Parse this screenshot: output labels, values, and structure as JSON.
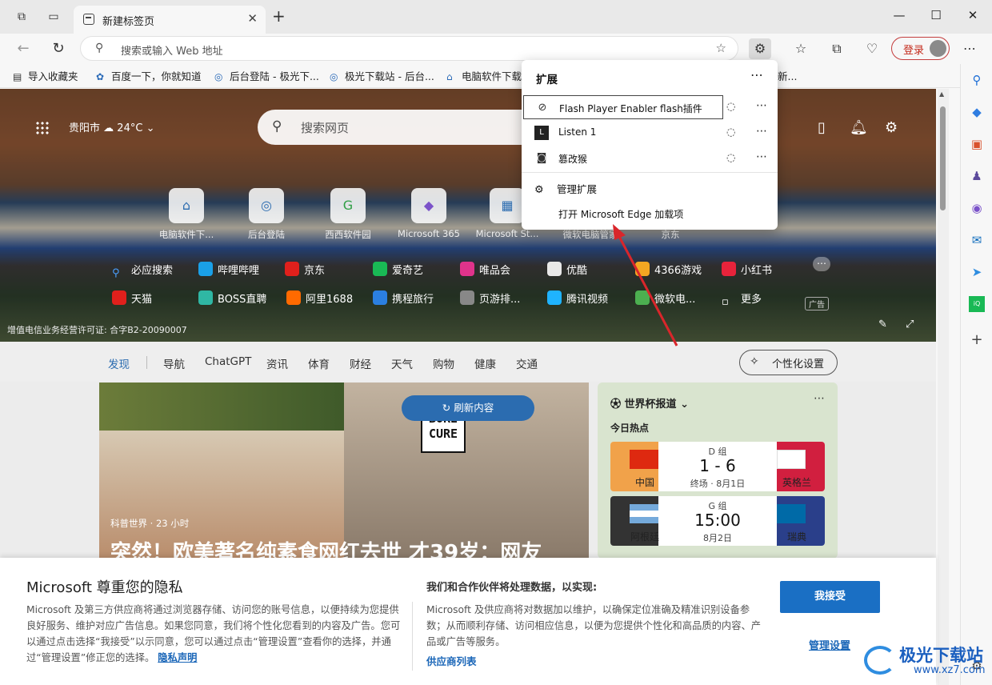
{
  "tab": {
    "title": "新建标签页"
  },
  "address": {
    "placeholder": "搜索或输入 Web 地址"
  },
  "toolbar": {
    "login": "登录"
  },
  "favorites": [
    {
      "label": "导入收藏夹"
    },
    {
      "label": "百度一下，你就知道"
    },
    {
      "label": "后台登陆 - 极光下..."
    },
    {
      "label": "极光下载站 - 后台..."
    },
    {
      "label": "电脑软件下载"
    },
    {
      "label": "新..."
    }
  ],
  "hero": {
    "city": "贵阳市",
    "temp": "24°C",
    "search_placeholder": "搜索网页",
    "tiles": [
      "电脑软件下...",
      "后台登陆",
      "西西软件园",
      "Microsoft 365",
      "Microsoft St...",
      "微软电脑管家",
      "京东"
    ],
    "links_row1": [
      "必应搜索",
      "哔哩哔哩",
      "京东",
      "爱奇艺",
      "唯品会",
      "优酷",
      "4366游戏",
      "小红书"
    ],
    "links_row2": [
      "天猫",
      "BOSS直聘",
      "阿里1688",
      "携程旅行",
      "页游排...",
      "腾讯视频",
      "微软电...",
      "更多"
    ],
    "ad": "广告",
    "license": "增值电信业务经营许可证: 合字B2-20090007"
  },
  "feed_nav": {
    "items": [
      "发现",
      "导航",
      "ChatGPT",
      "资讯",
      "体育",
      "财经",
      "天气",
      "购物",
      "健康",
      "交通"
    ],
    "personalize": "个性化设置"
  },
  "news": {
    "refresh": "刷新内容",
    "board": "BORE CURE",
    "source": "科普世界 · 23 小时",
    "headline": "突然！欧美著名纯素食网红去世 才39岁：网友"
  },
  "worldcup": {
    "title": "世界杯报道",
    "hot": "今日热点",
    "matches": [
      {
        "group": "D 组",
        "home": "中国",
        "away": "英格兰",
        "score": "1 - 6",
        "date": "终场 · 8月1日"
      },
      {
        "group": "G 组",
        "home": "阿根廷",
        "away": "瑞典",
        "score": "15:00",
        "date": "8月2日"
      }
    ]
  },
  "extensions_popup": {
    "title": "扩展",
    "items": [
      "Flash Player Enabler flash插件",
      "Listen 1",
      "篡改猴"
    ],
    "manage": "管理扩展",
    "open_addons": "打开 Microsoft Edge 加载项"
  },
  "privacy": {
    "title": "Microsoft 尊重您的隐私",
    "body": "Microsoft 及第三方供应商将通过浏览器存储、访问您的账号信息，以便持续为您提供良好服务、维护对应广告信息。如果您同意，我们将个性化您看到的内容及广告。您可以通过点击选择“我接受”以示同意，您可以通过点击“管理设置”查看你的选择，并通过“管理设置”修正您的选择。",
    "privacy_link": "隐私声明",
    "heading2": "我们和合作伙伴将处理数据，以实现:",
    "body2": "Microsoft 及供应商将对数据加以维护，以确保定位准确及精准识别设备参数；从而顺利存储、访问相应信息，以便为您提供个性化和高品质的内容、产品或广告等服务。",
    "vendors": "供应商列表",
    "accept": "我接受",
    "manage": "管理设置"
  },
  "watermark": {
    "name": "极光下载站",
    "url": "www.xz7.com"
  }
}
